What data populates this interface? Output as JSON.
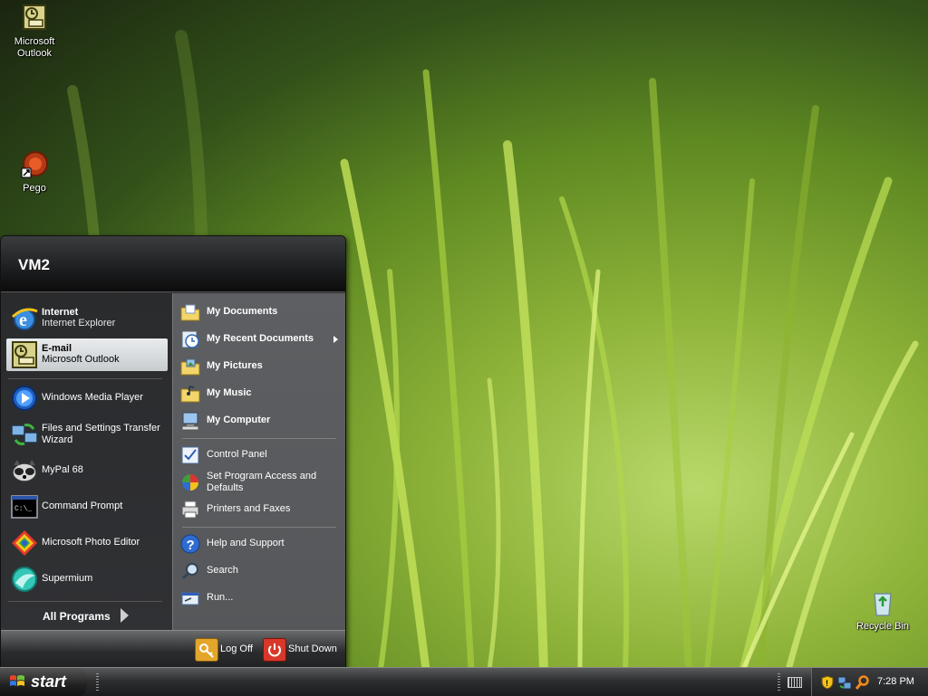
{
  "desktop": {
    "icons": [
      {
        "label": "Microsoft\nOutlook",
        "line1": "Microsoft",
        "line2": "Outlook",
        "icon": "outlook-icon"
      },
      {
        "label": "Pego",
        "icon": "pego-shortcut-icon"
      },
      {
        "label": "Recycle Bin",
        "icon": "recycle-bin-icon"
      }
    ]
  },
  "start_menu": {
    "user": "VM2",
    "pinned": [
      {
        "title": "Internet",
        "subtitle": "Internet Explorer",
        "icon": "internet-explorer-icon"
      },
      {
        "title": "E-mail",
        "subtitle": "Microsoft Outlook",
        "icon": "outlook-icon",
        "selected": true
      }
    ],
    "recent": [
      {
        "title": "Windows Media Player",
        "icon": "media-player-icon"
      },
      {
        "title": "Files and Settings Transfer",
        "title2": "Wizard",
        "icon": "transfer-wizard-icon"
      },
      {
        "title": "MyPal 68",
        "icon": "mypal-icon"
      },
      {
        "title": "Command Prompt",
        "icon": "command-prompt-icon"
      },
      {
        "title": "Microsoft Photo Editor",
        "icon": "photo-editor-icon"
      },
      {
        "title": "Supermium",
        "icon": "supermium-icon"
      }
    ],
    "all_programs": "All Programs",
    "places": [
      {
        "label": "My Documents",
        "icon": "folder-documents-icon"
      },
      {
        "label": "My Recent Documents",
        "icon": "recent-documents-icon",
        "has_submenu": true
      },
      {
        "label": "My Pictures",
        "icon": "folder-pictures-icon"
      },
      {
        "label": "My Music",
        "icon": "folder-music-icon"
      },
      {
        "label": "My Computer",
        "icon": "computer-icon"
      }
    ],
    "settings": [
      {
        "label": "Control Panel",
        "icon": "control-panel-icon"
      },
      {
        "label": "Set Program Access and",
        "label2": "Defaults",
        "icon": "program-access-icon"
      },
      {
        "label": "Printers and Faxes",
        "icon": "printer-icon"
      }
    ],
    "help": [
      {
        "label": "Help and Support",
        "icon": "help-icon"
      },
      {
        "label": "Search",
        "icon": "search-icon"
      },
      {
        "label": "Run...",
        "icon": "run-icon"
      }
    ],
    "log_off": "Log Off",
    "shut_down": "Shut Down"
  },
  "taskbar": {
    "start_label": "start",
    "clock": "7:28 PM"
  },
  "colors": {
    "selection": "#dfe3e6",
    "taskbar_dark": "#1a1b1c",
    "wallpaper_green": "#8fb43a"
  }
}
